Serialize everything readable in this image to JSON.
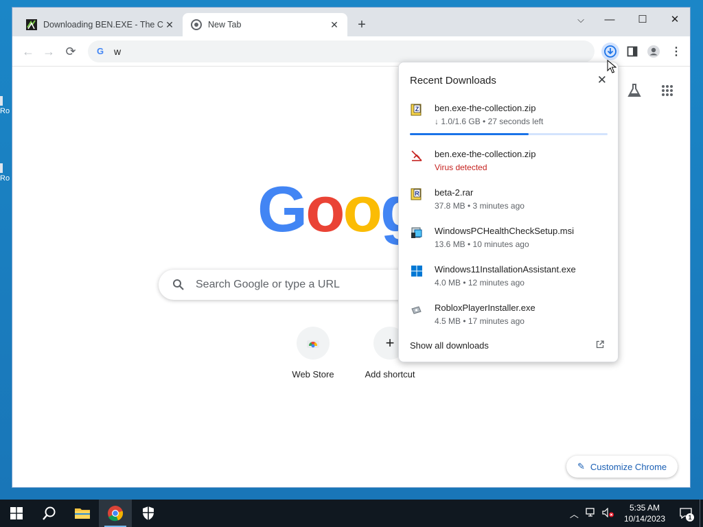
{
  "desktop": {
    "icons": [
      {
        "label": "Ro"
      },
      {
        "label": "Ro"
      }
    ]
  },
  "browser": {
    "tabs": [
      {
        "title": "Downloading BEN.EXE - The Coll"
      },
      {
        "title": "New Tab"
      }
    ],
    "omnibox_value": "w"
  },
  "ntp": {
    "search_placeholder": "Search Google or type a URL",
    "shortcuts": [
      {
        "label": "Web Store"
      },
      {
        "label": "Add shortcut"
      }
    ],
    "customize_label": "Customize Chrome"
  },
  "downloads_bubble": {
    "title": "Recent Downloads",
    "items": [
      {
        "name": "ben.exe-the-collection.zip",
        "meta": "↓ 1.0/1.6 GB • 27 seconds left",
        "progress": 0.6
      },
      {
        "name": "ben.exe-the-collection.zip",
        "meta": "Virus detected"
      },
      {
        "name": "beta-2.rar",
        "meta": "37.8 MB • 3 minutes ago"
      },
      {
        "name": "WindowsPCHealthCheckSetup.msi",
        "meta": "13.6 MB • 10 minutes ago"
      },
      {
        "name": "Windows11InstallationAssistant.exe",
        "meta": "4.0 MB • 12 minutes ago"
      },
      {
        "name": "RobloxPlayerInstaller.exe",
        "meta": "4.5 MB • 17 minutes ago"
      }
    ],
    "show_all_label": "Show all downloads"
  },
  "taskbar": {
    "time": "5:35 AM",
    "date": "10/14/2023",
    "notification_count": "1"
  },
  "colors": {
    "accent": "#1a73e8",
    "danger": "#c5221f",
    "taskbar": "#101820",
    "desktop": "#1a7fc1"
  }
}
